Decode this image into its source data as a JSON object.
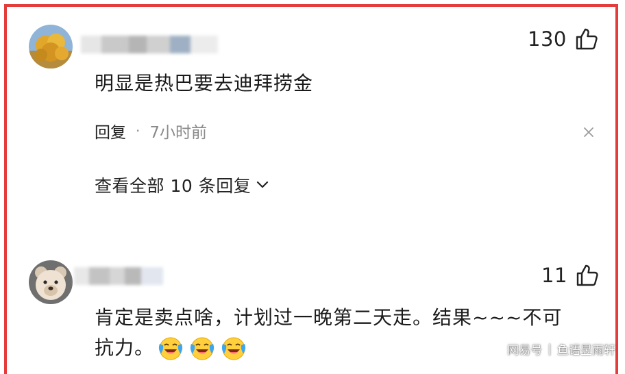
{
  "comments": [
    {
      "likes": "130",
      "text": "明显是热巴要去迪拜捞金",
      "reply_label": "回复",
      "separator": "·",
      "time": "7小时前",
      "view_all": "查看全部 10 条回复"
    },
    {
      "likes": "11",
      "text_line1": "肯定是卖点啥，计划过一晚第二天走。结果~~~不可",
      "text_line2": "抗力。"
    }
  ],
  "watermark": {
    "left": "网易号",
    "separator": "|",
    "right": "鱼语昱雨轩"
  },
  "colors": {
    "frame_border": "#e43b3b",
    "meta_gray": "#8a8a8a"
  },
  "icons": [
    "thumbs-up-icon",
    "close-icon",
    "chevron-down-icon",
    "laughing-crying-emoji"
  ]
}
